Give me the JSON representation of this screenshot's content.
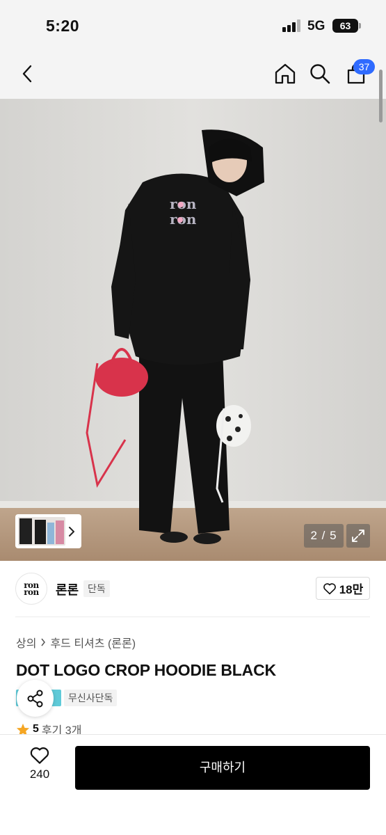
{
  "status_bar": {
    "time": "5:20",
    "network": "5G",
    "battery": "63"
  },
  "nav": {
    "cart_count": "37",
    "icons": [
      "back-icon",
      "home-icon",
      "search-icon",
      "cart-icon"
    ]
  },
  "gallery": {
    "page_indicator": "2 / 5",
    "current_page": 2,
    "total_pages": 5
  },
  "brand": {
    "logo_top": "ron",
    "logo_bottom": "ron",
    "name": "론론",
    "tag": "단독",
    "likes": "18만"
  },
  "breadcrumb": {
    "category": "상의",
    "subcategory": "후드 티셔츠 (론론)"
  },
  "product": {
    "title": "DOT LOGO CROP HOODIE BLACK",
    "badge": "무신사단독"
  },
  "rating": {
    "score": "5",
    "reviews": "후기 3개"
  },
  "bottom_bar": {
    "wish_count": "240",
    "buy_label": "구매하기"
  },
  "colors": {
    "accent": "#2f6bff",
    "buy_button": "#000000",
    "star": "#f5a623",
    "exclusive_badge": "#5fcad8"
  }
}
